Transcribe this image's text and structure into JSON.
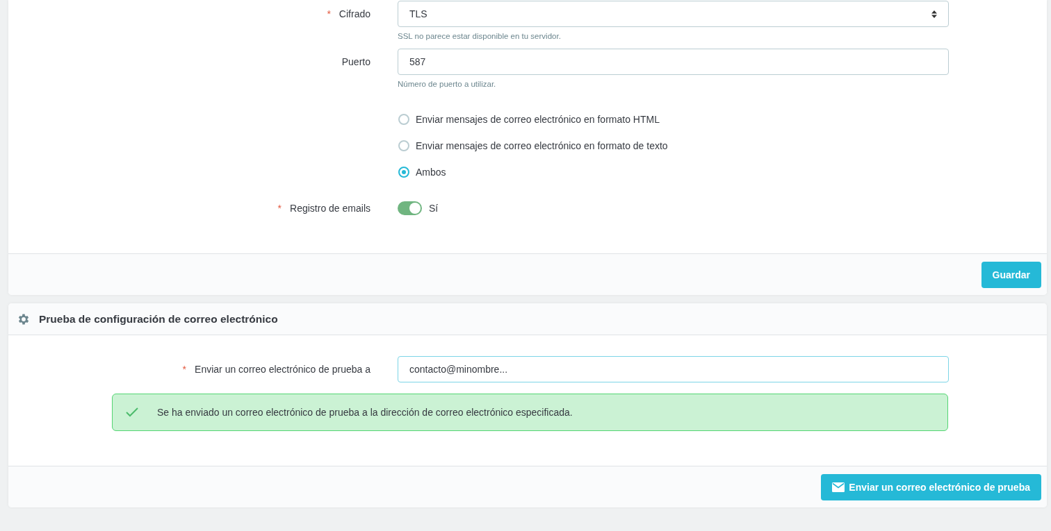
{
  "settings_card": {
    "fields": [
      {
        "kind": "select",
        "label": "Cifrado",
        "required_mark": "*",
        "value": "TLS",
        "help": "SSL no parece estar disponible en tu servidor."
      },
      {
        "kind": "text",
        "label": "Puerto",
        "value": "587",
        "help": "Número de puerto a utilizar."
      },
      {
        "kind": "radio",
        "options": [
          {
            "label": "Enviar mensajes de correo electrónico en formato HTML",
            "selected": false
          },
          {
            "label": "Enviar mensajes de correo electrónico en formato de texto",
            "selected": false
          },
          {
            "label": "Ambos",
            "selected": true
          }
        ]
      },
      {
        "kind": "switch",
        "label": "Registro de emails",
        "required_mark": "*",
        "on": true,
        "value_label": "Sí"
      }
    ],
    "save_button": "Guardar"
  },
  "test_card": {
    "title": "Prueba de configuración de correo electrónico",
    "field": {
      "label": "Enviar un correo electrónico de prueba a",
      "required_mark": "*",
      "value": "contacto@minombre..."
    },
    "alert": {
      "message": "Se ha enviado un correo electrónico de prueba a la dirección de correo electrónico especificada."
    },
    "send_button": "Enviar un correo electrónico de prueba"
  }
}
